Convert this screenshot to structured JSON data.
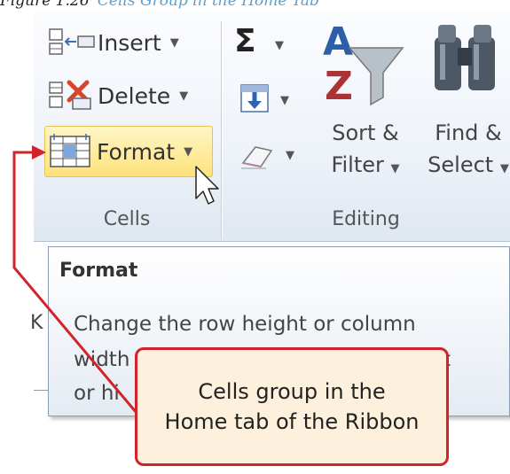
{
  "caption": {
    "figure": "Figure 1.26",
    "text": "Cells Group in the Home Tab"
  },
  "ribbon": {
    "cells_group": {
      "label": "Cells",
      "buttons": [
        {
          "label": "Insert",
          "icon": "insert-cells-icon"
        },
        {
          "label": "Delete",
          "icon": "delete-cells-icon"
        },
        {
          "label": "Format",
          "icon": "format-cells-icon",
          "state": "hover"
        }
      ]
    },
    "editing_group": {
      "label": "Editing",
      "autosum_icon": "sigma-icon",
      "fill_icon": "fill-down-icon",
      "clear_icon": "eraser-icon",
      "sort_filter": {
        "line1": "Sort &",
        "line2": "Filter"
      },
      "find_select": {
        "line1": "Find &",
        "line2": "Select"
      }
    }
  },
  "tooltip": {
    "title": "Format",
    "lines": [
      "Change the row height or column",
      "width",
      "t",
      "or hi"
    ]
  },
  "background": {
    "letter": "K"
  },
  "callout": {
    "line1": "Cells group in the",
    "line2": "Home tab of the Ribbon"
  },
  "colors": {
    "callout_border": "#d2232a",
    "callout_fill": "#fdf0dc",
    "hover_fill": "#fde27a",
    "caption_accent": "#5a9fcf"
  }
}
